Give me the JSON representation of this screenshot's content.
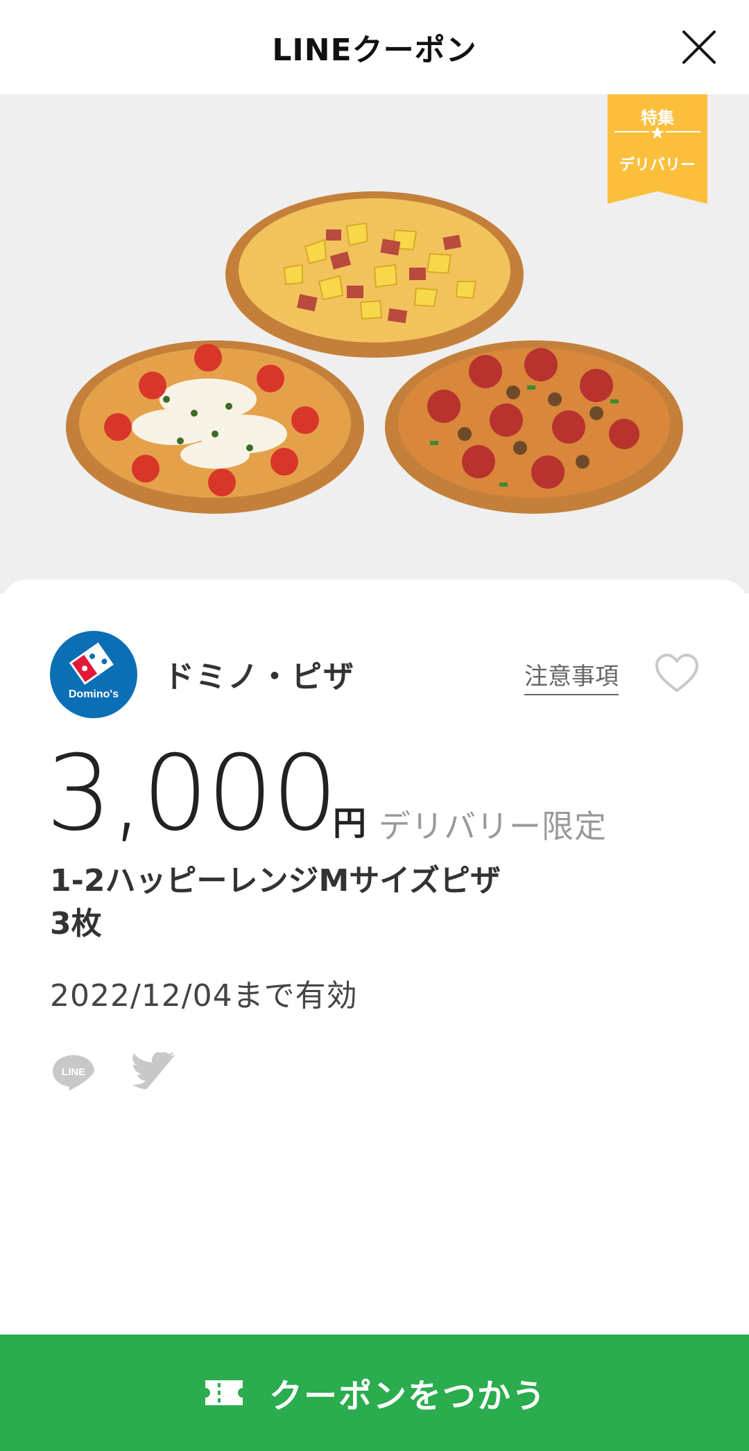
{
  "header": {
    "title": "LINEクーポン"
  },
  "badge": {
    "top": "特集",
    "bottom": "デリバリー"
  },
  "brand": {
    "name": "ドミノ・ピザ",
    "logo_text": "Domino's"
  },
  "notice_link": "注意事項",
  "coupon": {
    "amount": "3,000",
    "currency": "円",
    "condition": "デリバリー限定",
    "product_line1": "1-2ハッピーレンジMサイズピザ",
    "product_line2": "3枚",
    "validity": "2022/12/04まで有効"
  },
  "share": {
    "line_label": "LINE"
  },
  "cta": {
    "label": "クーポンをつかう"
  },
  "colors": {
    "accent_green": "#2bac4e",
    "badge_yellow": "#fbbf3c",
    "domino_blue": "#0a6fb5",
    "domino_red": "#e31837"
  }
}
